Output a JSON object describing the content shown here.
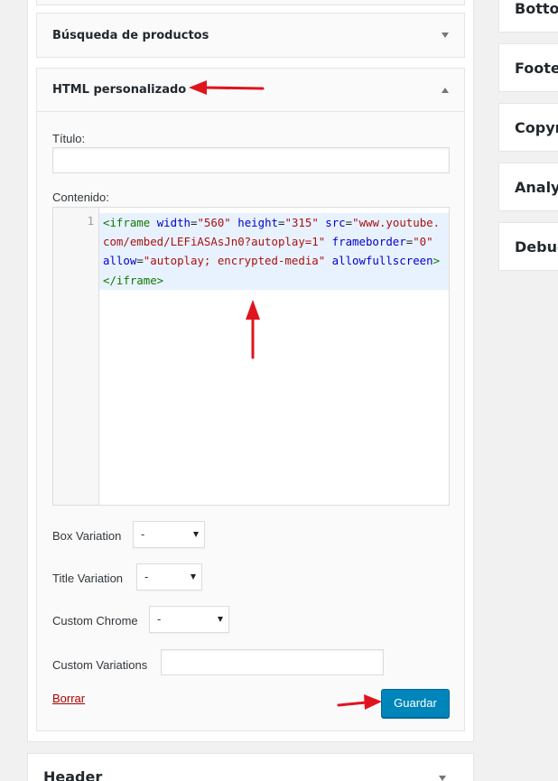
{
  "widgets": {
    "busqueda": {
      "title": "Búsqueda de productos"
    },
    "html": {
      "title": "HTML personalizado",
      "titulo_label": "Título:",
      "titulo_value": "",
      "contenido_label": "Contenido:",
      "code": {
        "line_number": "1",
        "tokens": [
          {
            "t": "tag",
            "v": "<iframe"
          },
          {
            "t": "plain",
            "v": " "
          },
          {
            "t": "attr",
            "v": "width"
          },
          {
            "t": "plain",
            "v": "="
          },
          {
            "t": "str",
            "v": "\"560\""
          },
          {
            "t": "plain",
            "v": " "
          },
          {
            "t": "attr",
            "v": "height"
          },
          {
            "t": "plain",
            "v": "="
          },
          {
            "t": "str",
            "v": "\"315\""
          },
          {
            "t": "plain",
            "v": " "
          },
          {
            "t": "attr",
            "v": "src"
          },
          {
            "t": "plain",
            "v": "="
          },
          {
            "t": "str",
            "v": "\"www.youtube.com/embed/LEFiASAsJn0?autoplay=1\""
          },
          {
            "t": "plain",
            "v": " "
          },
          {
            "t": "attr",
            "v": "frameborder"
          },
          {
            "t": "plain",
            "v": "="
          },
          {
            "t": "str",
            "v": "\"0\""
          },
          {
            "t": "plain",
            "v": " "
          },
          {
            "t": "attr",
            "v": "allow"
          },
          {
            "t": "plain",
            "v": "="
          },
          {
            "t": "str",
            "v": "\"autoplay; encrypted-media\""
          },
          {
            "t": "plain",
            "v": " "
          },
          {
            "t": "attr",
            "v": "allowfullscreen"
          },
          {
            "t": "tag",
            "v": "></iframe>"
          }
        ]
      },
      "box_variation": {
        "label": "Box Variation",
        "value": "-"
      },
      "title_variation": {
        "label": "Title Variation",
        "value": "-"
      },
      "custom_chrome": {
        "label": "Custom Chrome",
        "value": "-"
      },
      "custom_variations": {
        "label": "Custom Variations",
        "value": ""
      },
      "delete_label": "Borrar",
      "save_label": "Guardar"
    },
    "header": {
      "title": "Header"
    }
  },
  "right_column": [
    {
      "label": "Botto"
    },
    {
      "label": "Foote"
    },
    {
      "label": "Copyr"
    },
    {
      "label": "Analy"
    },
    {
      "label": "Debug"
    }
  ],
  "colors": {
    "primary_button": "#0085ba",
    "delete_link": "#a00",
    "annotation_arrow": "#e0141e",
    "code_highlight": "#e8f2fe"
  }
}
